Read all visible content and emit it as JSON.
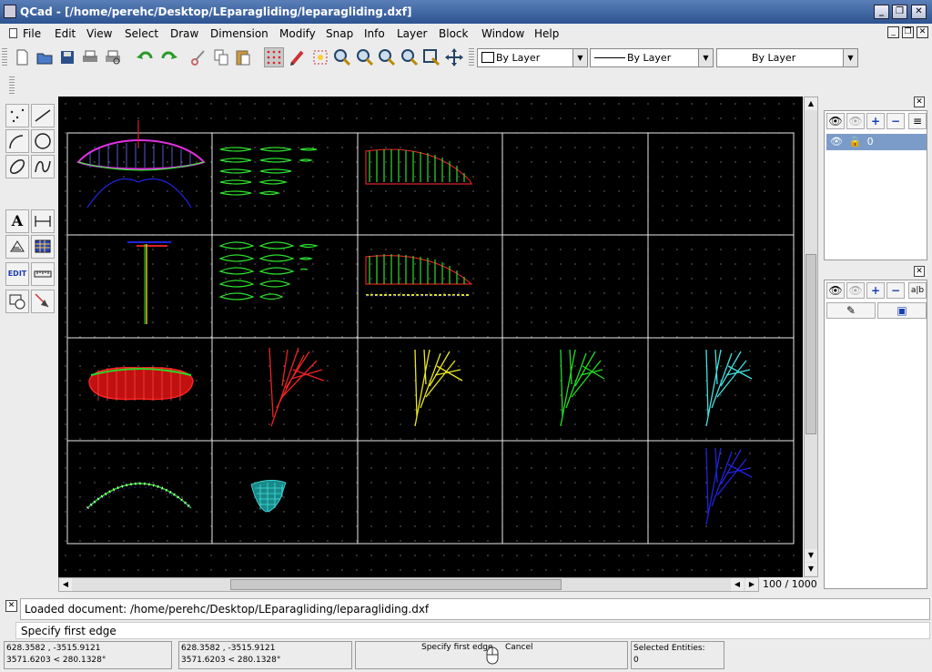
{
  "window": {
    "title": "QCad - [/home/perehc/Desktop/LEparagliding/leparagliding.dxf]",
    "buttons": [
      "_",
      "❐",
      "✕"
    ]
  },
  "menubar": {
    "items": [
      "File",
      "Edit",
      "View",
      "Select",
      "Draw",
      "Dimension",
      "Modify",
      "Snap",
      "Info",
      "Layer",
      "Block",
      "Window",
      "Help"
    ],
    "mdi_buttons": [
      "_",
      "❐",
      "✕"
    ]
  },
  "toolbar": {
    "color_combo": "By Layer",
    "linetype_combo": "By Layer",
    "width_combo": "By Layer",
    "icons": [
      "new-icon",
      "open-icon",
      "save-icon",
      "print-icon",
      "print-preview-icon",
      "undo-icon",
      "redo-icon",
      "cut-icon",
      "copy-icon",
      "paste-icon",
      "grid-icon",
      "redraw-icon",
      "zoom-auto-icon",
      "zoom-in-icon",
      "zoom-out-icon",
      "zoom-previous-icon",
      "zoom-window-icon",
      "zoom-select-icon",
      "pan-icon"
    ]
  },
  "left_tools": {
    "text_label": "A",
    "edit_label": "EDIT"
  },
  "canvas": {
    "zoom": "100 / 1000"
  },
  "layers": {
    "items": [
      {
        "name": "0"
      }
    ]
  },
  "blocks": {
    "edit_label": "a|b"
  },
  "command": {
    "log": "Loaded document: /home/perehc/Desktop/LEparagliding/leparagliding.dxf",
    "prompt": "Specify first edge"
  },
  "status": {
    "abs_coord": "628.3582 , -3515.9121",
    "abs_polar": "3571.6203 < 280.1328°",
    "rel_coord": "628.3582 , -3515.9121",
    "rel_polar": "3571.6203 < 280.1328°",
    "mouse_left": "Specify first edge",
    "mouse_right": "Cancel",
    "selected_label": "Selected Entities:",
    "selected_count": "0"
  }
}
